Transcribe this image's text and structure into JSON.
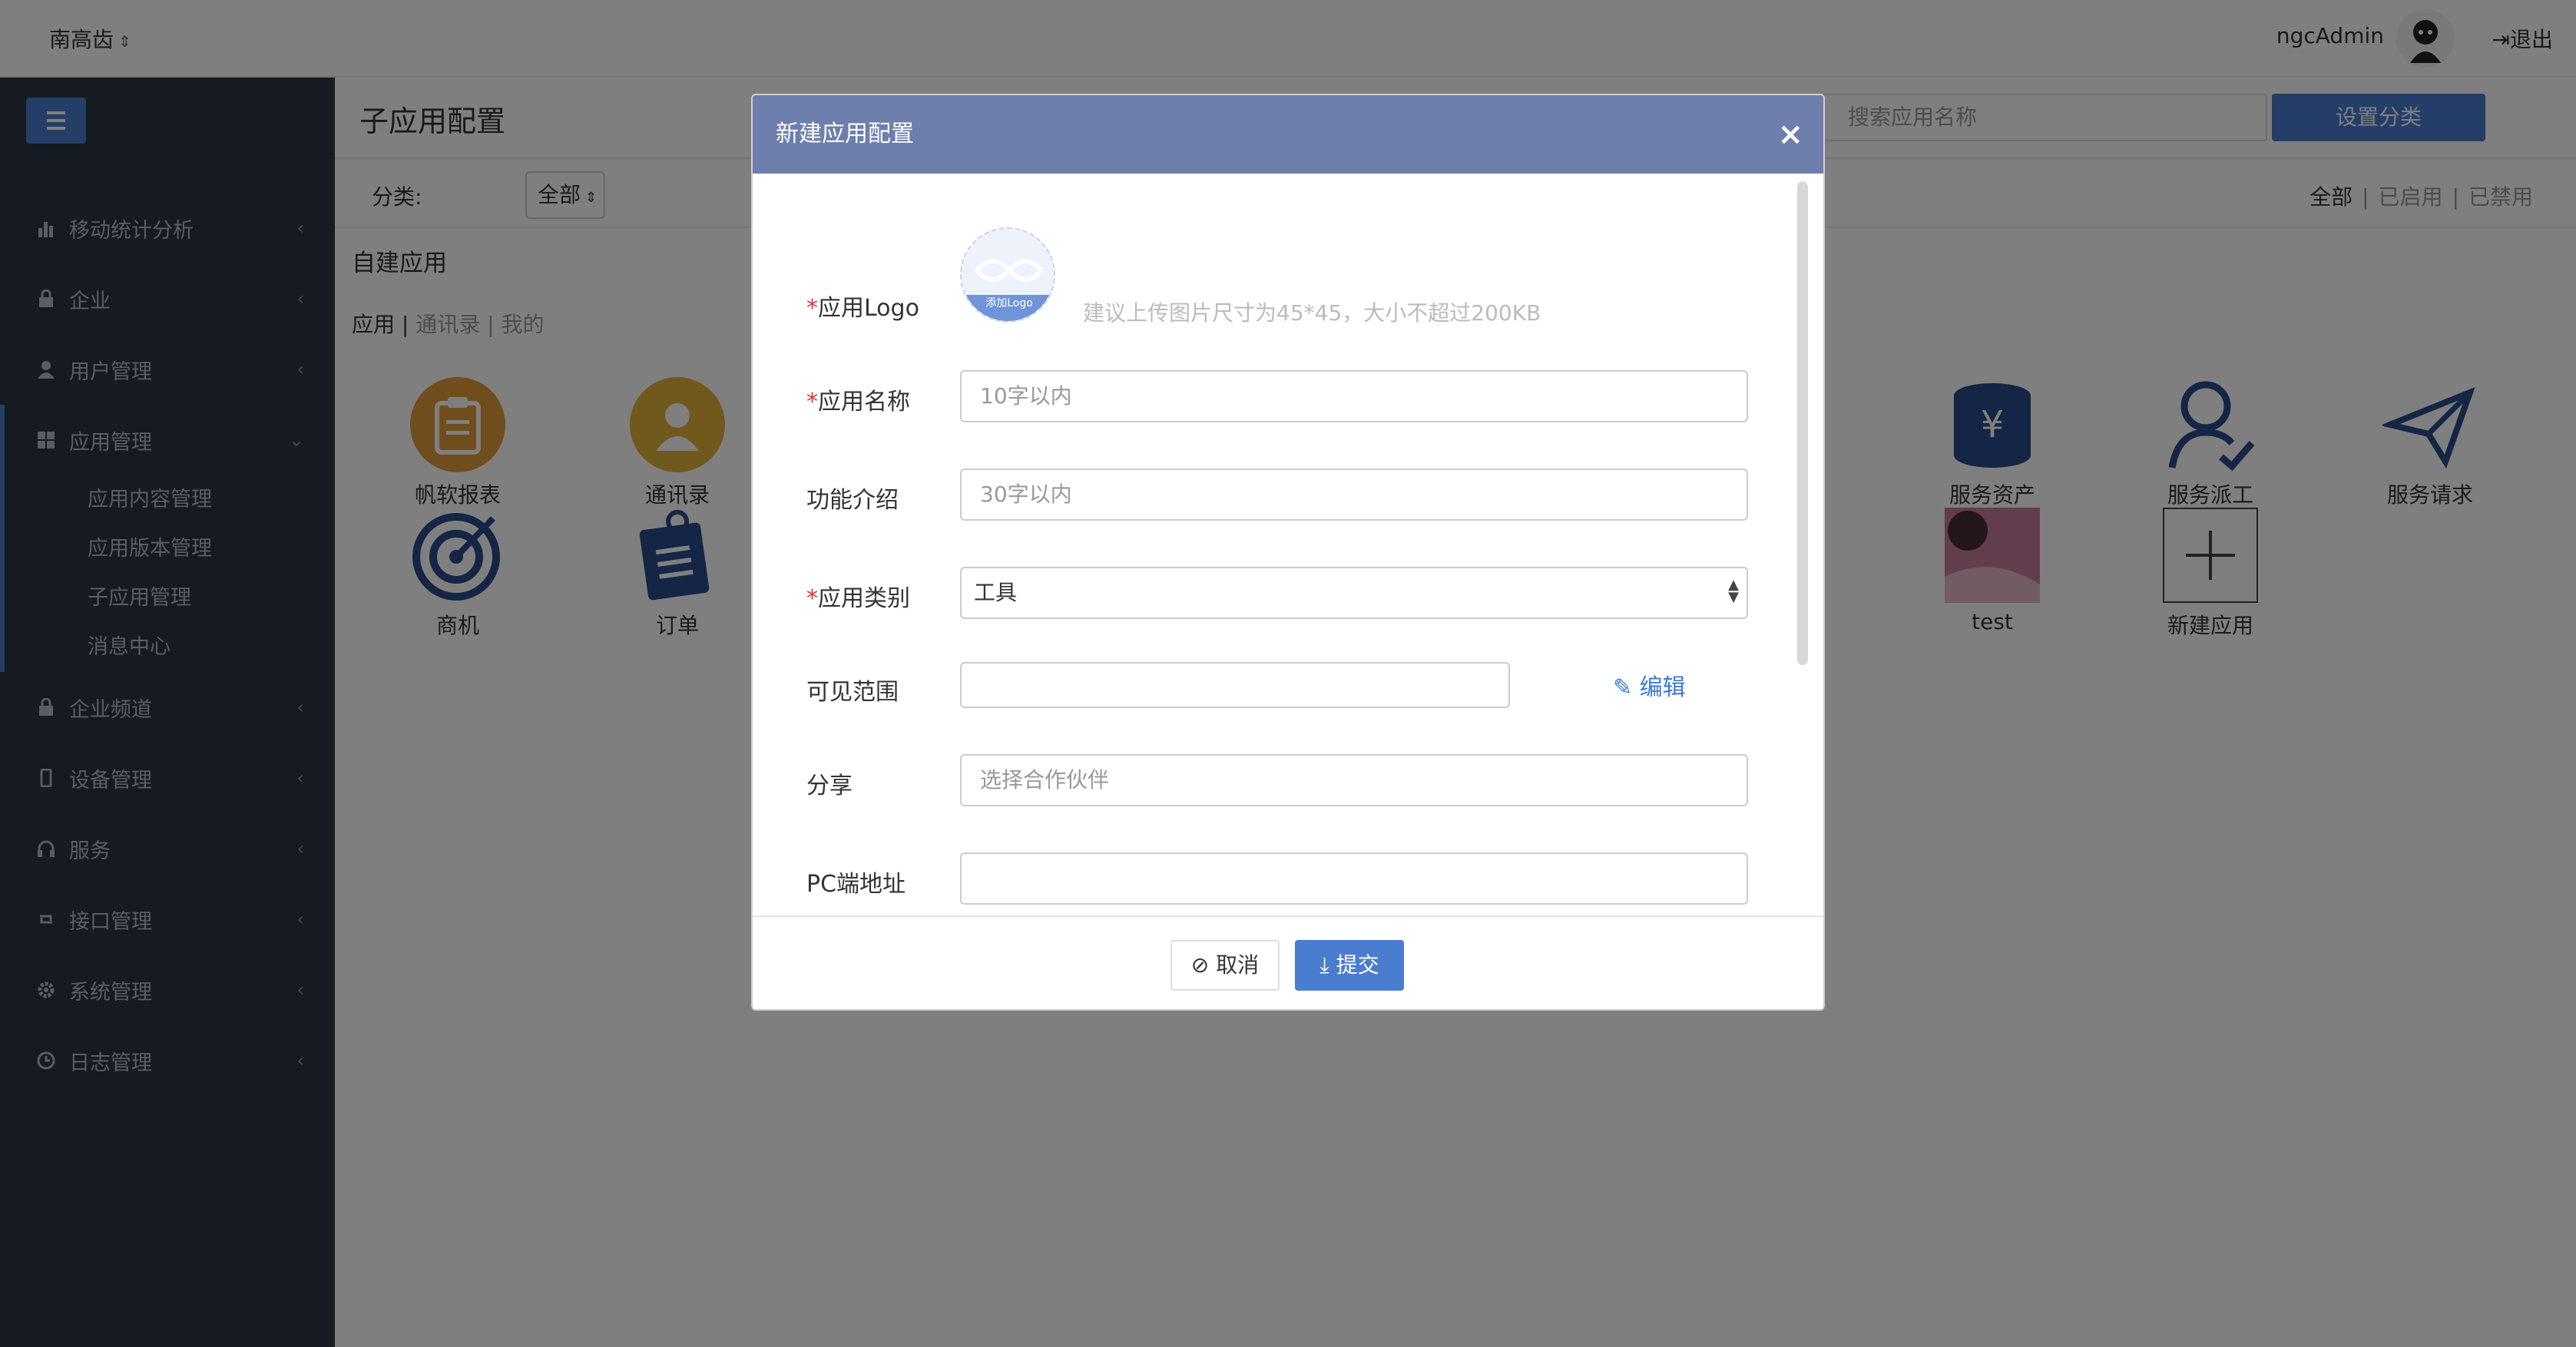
{
  "topbar": {
    "org": "南高齿",
    "user": "ngcAdmin",
    "logout": "退出"
  },
  "sidebar": {
    "items": [
      {
        "label": "移动统计分析"
      },
      {
        "label": "企业"
      },
      {
        "label": "用户管理"
      },
      {
        "label": "应用管理"
      },
      {
        "label": "企业频道"
      },
      {
        "label": "设备管理"
      },
      {
        "label": "服务"
      },
      {
        "label": "接口管理"
      },
      {
        "label": "系统管理"
      },
      {
        "label": "日志管理"
      }
    ],
    "sub": [
      "应用内容管理",
      "应用版本管理",
      "子应用管理",
      "消息中心"
    ]
  },
  "page": {
    "title": "子应用配置",
    "search_placeholder": "搜索应用名称",
    "set_category": "设置分类",
    "filter_label": "分类:",
    "filter_value": "全部",
    "status_all": "全部",
    "status_enabled": "已启用",
    "status_disabled": "已禁用",
    "section": "自建应用",
    "tab_app": "应用",
    "tab_contacts": "通讯录",
    "tab_mine": "我的"
  },
  "apps": [
    {
      "label": "帆软报表"
    },
    {
      "label": "通讯录"
    },
    {
      "label": "商机"
    },
    {
      "label": "订单"
    },
    {
      "label": "服务资产"
    },
    {
      "label": "服务派工"
    },
    {
      "label": "服务请求"
    },
    {
      "label": "test"
    },
    {
      "label": "新建应用"
    }
  ],
  "modal": {
    "title": "新建应用配置",
    "logo_label": "应用Logo",
    "logo_badge": "添加Logo",
    "logo_hint": "建议上传图片尺寸为45*45，大小不超过200KB",
    "name_label": "应用名称",
    "name_placeholder": "10字以内",
    "intro_label": "功能介绍",
    "intro_placeholder": "30字以内",
    "category_label": "应用类别",
    "category_value": "工具",
    "scope_label": "可见范围",
    "scope_edit": "编辑",
    "share_label": "分享",
    "share_placeholder": "选择合作伙伴",
    "pc_label": "PC端地址",
    "cancel": "取消",
    "submit": "提交"
  },
  "colors": {
    "accent": "#4a7ccf",
    "sidebar_bg": "#2b3643",
    "modal_header": "#6e7fae"
  }
}
